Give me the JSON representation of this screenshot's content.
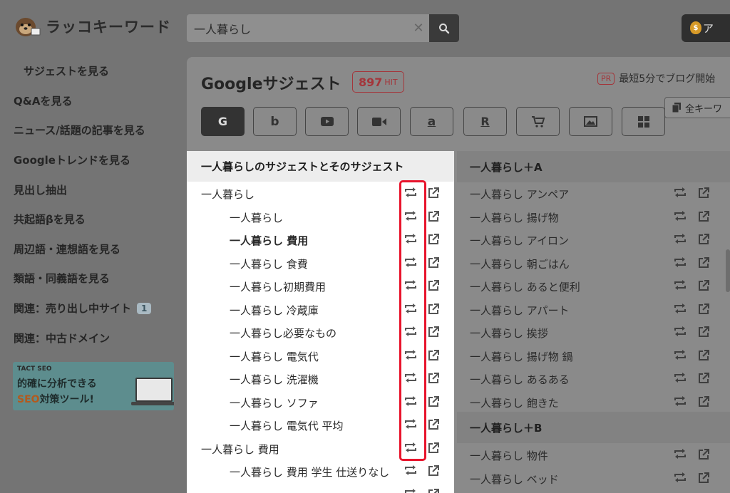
{
  "header": {
    "logo_text": "ラッコキーワード",
    "search_value": "一人暮らし",
    "top_right_label": "ア"
  },
  "sidebar": {
    "items": [
      {
        "label": "サジェストを見る",
        "active": true
      },
      {
        "label": "Q&Aを見る"
      },
      {
        "label": "ニュース/話題の記事を見る"
      },
      {
        "label": "Googleトレンドを見る"
      },
      {
        "label": "見出し抽出"
      },
      {
        "label": "共起語βを見る"
      },
      {
        "label": "周辺語・連想語を見る"
      },
      {
        "label": "類語・同義語を見る"
      },
      {
        "label": "関連：売り出し中サイト",
        "badge": "1"
      },
      {
        "label": "関連：中古ドメイン"
      }
    ],
    "ad": {
      "brand": "TACT SEO",
      "line1": "的確に分析できる",
      "line2_highlight": "SEO",
      "line2_rest": "対策ツール!"
    }
  },
  "main": {
    "title": "Googleサジェスト",
    "hit_count": "897",
    "hit_unit": "HIT",
    "pr_tag": "PR",
    "pr_text": "最短5分でブログ開始",
    "copy_label": "全キーワ",
    "engines": [
      {
        "name": "google",
        "glyph": "G",
        "active": true
      },
      {
        "name": "bing",
        "glyph": "b"
      },
      {
        "name": "youtube",
        "glyph": "▶"
      },
      {
        "name": "video",
        "glyph": "■"
      },
      {
        "name": "amazon",
        "glyph": "a"
      },
      {
        "name": "rakuten",
        "glyph": "R"
      },
      {
        "name": "shopping",
        "glyph": "🛒"
      },
      {
        "name": "image",
        "glyph": "▣"
      },
      {
        "name": "apps",
        "glyph": "▦"
      }
    ]
  },
  "left_column": {
    "header": "一人暮らしのサジェストとそのサジェスト",
    "rows": [
      {
        "text": "一人暮らし",
        "indent": 0,
        "bold": false
      },
      {
        "text": "一人暮らし",
        "indent": 1,
        "bold": false
      },
      {
        "text": "一人暮らし 費用",
        "indent": 1,
        "bold": true
      },
      {
        "text": "一人暮らし 食費",
        "indent": 1,
        "bold": false
      },
      {
        "text": "一人暮らし初期費用",
        "indent": 1,
        "bold": false
      },
      {
        "text": "一人暮らし 冷蔵庫",
        "indent": 1,
        "bold": false
      },
      {
        "text": "一人暮らし必要なもの",
        "indent": 1,
        "bold": false
      },
      {
        "text": "一人暮らし 電気代",
        "indent": 1,
        "bold": false
      },
      {
        "text": "一人暮らし 洗濯機",
        "indent": 1,
        "bold": false
      },
      {
        "text": "一人暮らし ソファ",
        "indent": 1,
        "bold": false
      },
      {
        "text": "一人暮らし 電気代 平均",
        "indent": 1,
        "bold": false
      },
      {
        "text": "一人暮らし 費用",
        "indent": 0,
        "bold": false
      },
      {
        "text": "一人暮らし 費用 学生 仕送りなし",
        "indent": 1,
        "bold": false
      },
      {
        "text": "",
        "indent": 1,
        "bold": false
      }
    ]
  },
  "right_column": {
    "sections": [
      {
        "header": "一人暮らし＋A",
        "rows": [
          "一人暮らし アンペア",
          "一人暮らし 揚げ物",
          "一人暮らし アイロン",
          "一人暮らし 朝ごはん",
          "一人暮らし あると便利",
          "一人暮らし アパート",
          "一人暮らし 挨拶",
          "一人暮らし 揚げ物 鍋",
          "一人暮らし あるある",
          "一人暮らし 飽きた"
        ]
      },
      {
        "header": "一人暮らし＋B",
        "rows": [
          "一人暮らし 物件",
          "一人暮らし ベッド"
        ]
      }
    ]
  }
}
